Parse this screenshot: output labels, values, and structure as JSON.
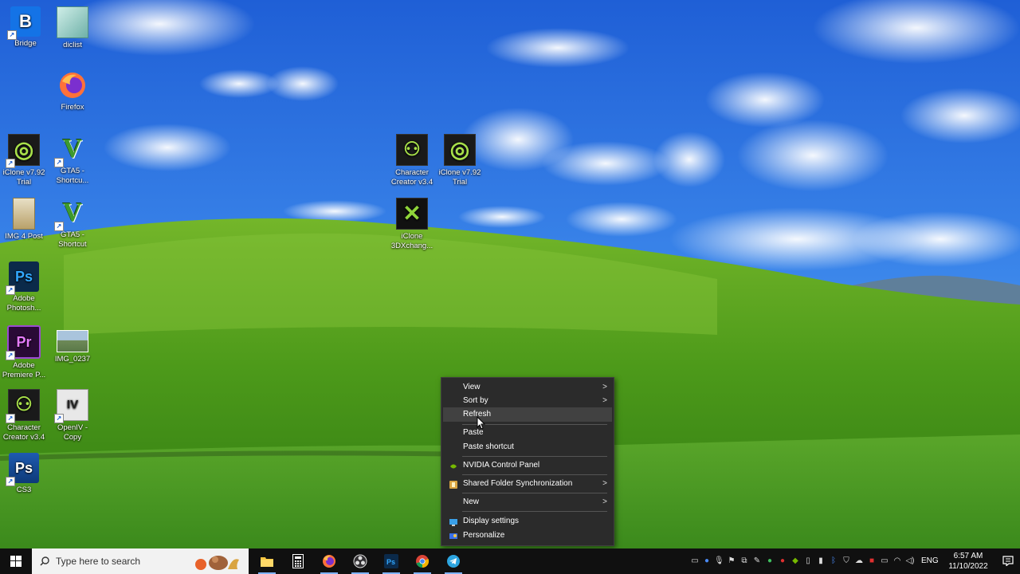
{
  "desktop_icons": [
    {
      "label": "Bridge",
      "icon": "bridge-icon",
      "bg": "#1473e6",
      "glyph": "B"
    },
    {
      "label": "diclist",
      "icon": "notepad-file-icon",
      "bg": "#9bd0c8",
      "glyph": ""
    },
    {
      "label": "Firefox",
      "icon": "firefox-icon",
      "bg": "#ff7139",
      "glyph": ""
    },
    {
      "label": "iClone v7.92 Trial",
      "icon": "iclone-icon",
      "bg": "#1a1a1a",
      "glyph": "◎"
    },
    {
      "label": "GTA5 - Shortcu...",
      "icon": "gta5-icon",
      "bg": "#3d7a2e",
      "glyph": "V"
    },
    {
      "label": "IMG 4 Post",
      "icon": "image-file-icon",
      "bg": "#c9b27a",
      "glyph": ""
    },
    {
      "label": "GTA5 - Shortcut",
      "icon": "gta5-icon",
      "bg": "#3d7a2e",
      "glyph": "V"
    },
    {
      "label": "Adobe Photosh...",
      "icon": "photoshop-icon",
      "bg": "#0b2a4a",
      "glyph": "Ps"
    },
    {
      "label": "Adobe Premiere P...",
      "icon": "premiere-icon",
      "bg": "#2a0a36",
      "glyph": "Pr"
    },
    {
      "label": "IMG_0237",
      "icon": "photo-thumbnail-icon",
      "bg": "#7a9a6a",
      "glyph": ""
    },
    {
      "label": "Character Creator v3.4",
      "icon": "character-creator-icon",
      "bg": "#1a1a1a",
      "glyph": "⚇"
    },
    {
      "label": "OpenIV - Copy",
      "icon": "openiv-icon",
      "bg": "#e8e8e8",
      "glyph": "IV"
    },
    {
      "label": "CS3",
      "icon": "photoshop-cs3-icon",
      "bg": "#0d3a78",
      "glyph": "Ps"
    },
    {
      "label": "Character Creator v3.4",
      "icon": "character-creator-icon",
      "bg": "#1a1a1a",
      "glyph": "⚇"
    },
    {
      "label": "iClone v7.92 Trial",
      "icon": "iclone-icon",
      "bg": "#1a1a1a",
      "glyph": "◎"
    },
    {
      "label": "iClone 3DXchang...",
      "icon": "3dxchange-icon",
      "bg": "#111",
      "glyph": "✕"
    }
  ],
  "context_menu": {
    "items": [
      {
        "label": "View",
        "submenu": true
      },
      {
        "label": "Sort by",
        "submenu": true
      },
      {
        "label": "Refresh",
        "submenu": false,
        "hover": true
      },
      {
        "label": "Paste",
        "submenu": false
      },
      {
        "label": "Paste shortcut",
        "submenu": false
      },
      {
        "label": "NVIDIA Control Panel",
        "submenu": false,
        "icon": "nvidia-icon"
      },
      {
        "label": "Shared Folder Synchronization",
        "submenu": true,
        "icon": "shared-folder-icon"
      },
      {
        "label": "New",
        "submenu": true
      },
      {
        "label": "Display settings",
        "submenu": false,
        "icon": "display-icon"
      },
      {
        "label": "Personalize",
        "submenu": false,
        "icon": "personalize-icon"
      }
    ]
  },
  "taskbar": {
    "search_placeholder": "Type here to search",
    "apps": [
      {
        "name": "file-explorer",
        "icon": "folder-icon",
        "active": true
      },
      {
        "name": "calculator",
        "icon": "calculator-icon",
        "active": false
      },
      {
        "name": "firefox",
        "icon": "firefox-icon",
        "active": true
      },
      {
        "name": "obs",
        "icon": "obs-icon",
        "active": true
      },
      {
        "name": "photoshop",
        "icon": "photoshop-icon",
        "active": true
      },
      {
        "name": "chrome",
        "icon": "chrome-icon",
        "active": true
      },
      {
        "name": "telegram",
        "icon": "telegram-icon",
        "active": true
      }
    ],
    "language": "ENG",
    "time": "6:57 AM",
    "date": "11/10/2022"
  },
  "colors": {
    "menu_bg": "#2b2b2b",
    "menu_hover": "#414141",
    "taskbar_bg": "#101010",
    "accent": "#7fb3ff"
  }
}
